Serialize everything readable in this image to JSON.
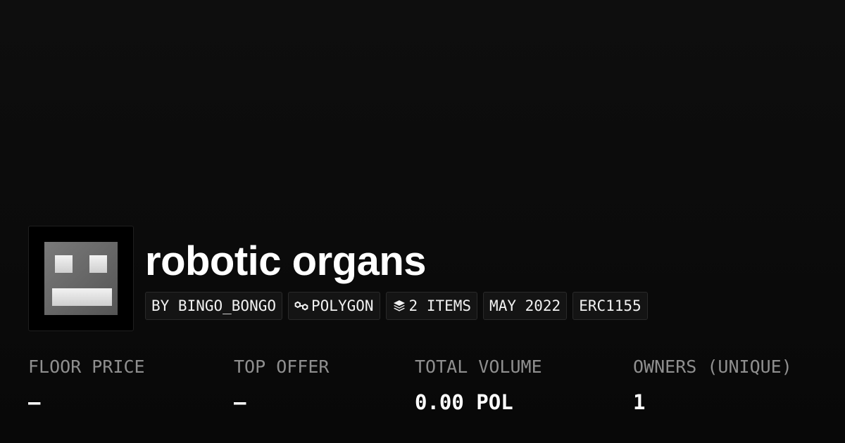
{
  "collection": {
    "name": "robotic organs",
    "avatar_icon": "robot-face-icon"
  },
  "tags": {
    "creator": "BY BINGO_BONGO",
    "chain": "POLYGON",
    "chain_icon": "polygon-link-icon",
    "items": "2 ITEMS",
    "items_icon": "layers-icon",
    "date": "MAY 2022",
    "standard": "ERC1155"
  },
  "stats": {
    "floor_price": {
      "label": "FLOOR PRICE",
      "value": "–"
    },
    "top_offer": {
      "label": "TOP OFFER",
      "value": "–"
    },
    "total_volume": {
      "label": "TOTAL VOLUME",
      "value": "0.00 POL"
    },
    "owners": {
      "label": "OWNERS (UNIQUE)",
      "value": "1"
    }
  },
  "colors": {
    "background": "#0b0b0b",
    "tag_background": "#141414",
    "tag_border": "#2a2a2a",
    "label": "#8f8f8f",
    "text": "#ffffff"
  }
}
